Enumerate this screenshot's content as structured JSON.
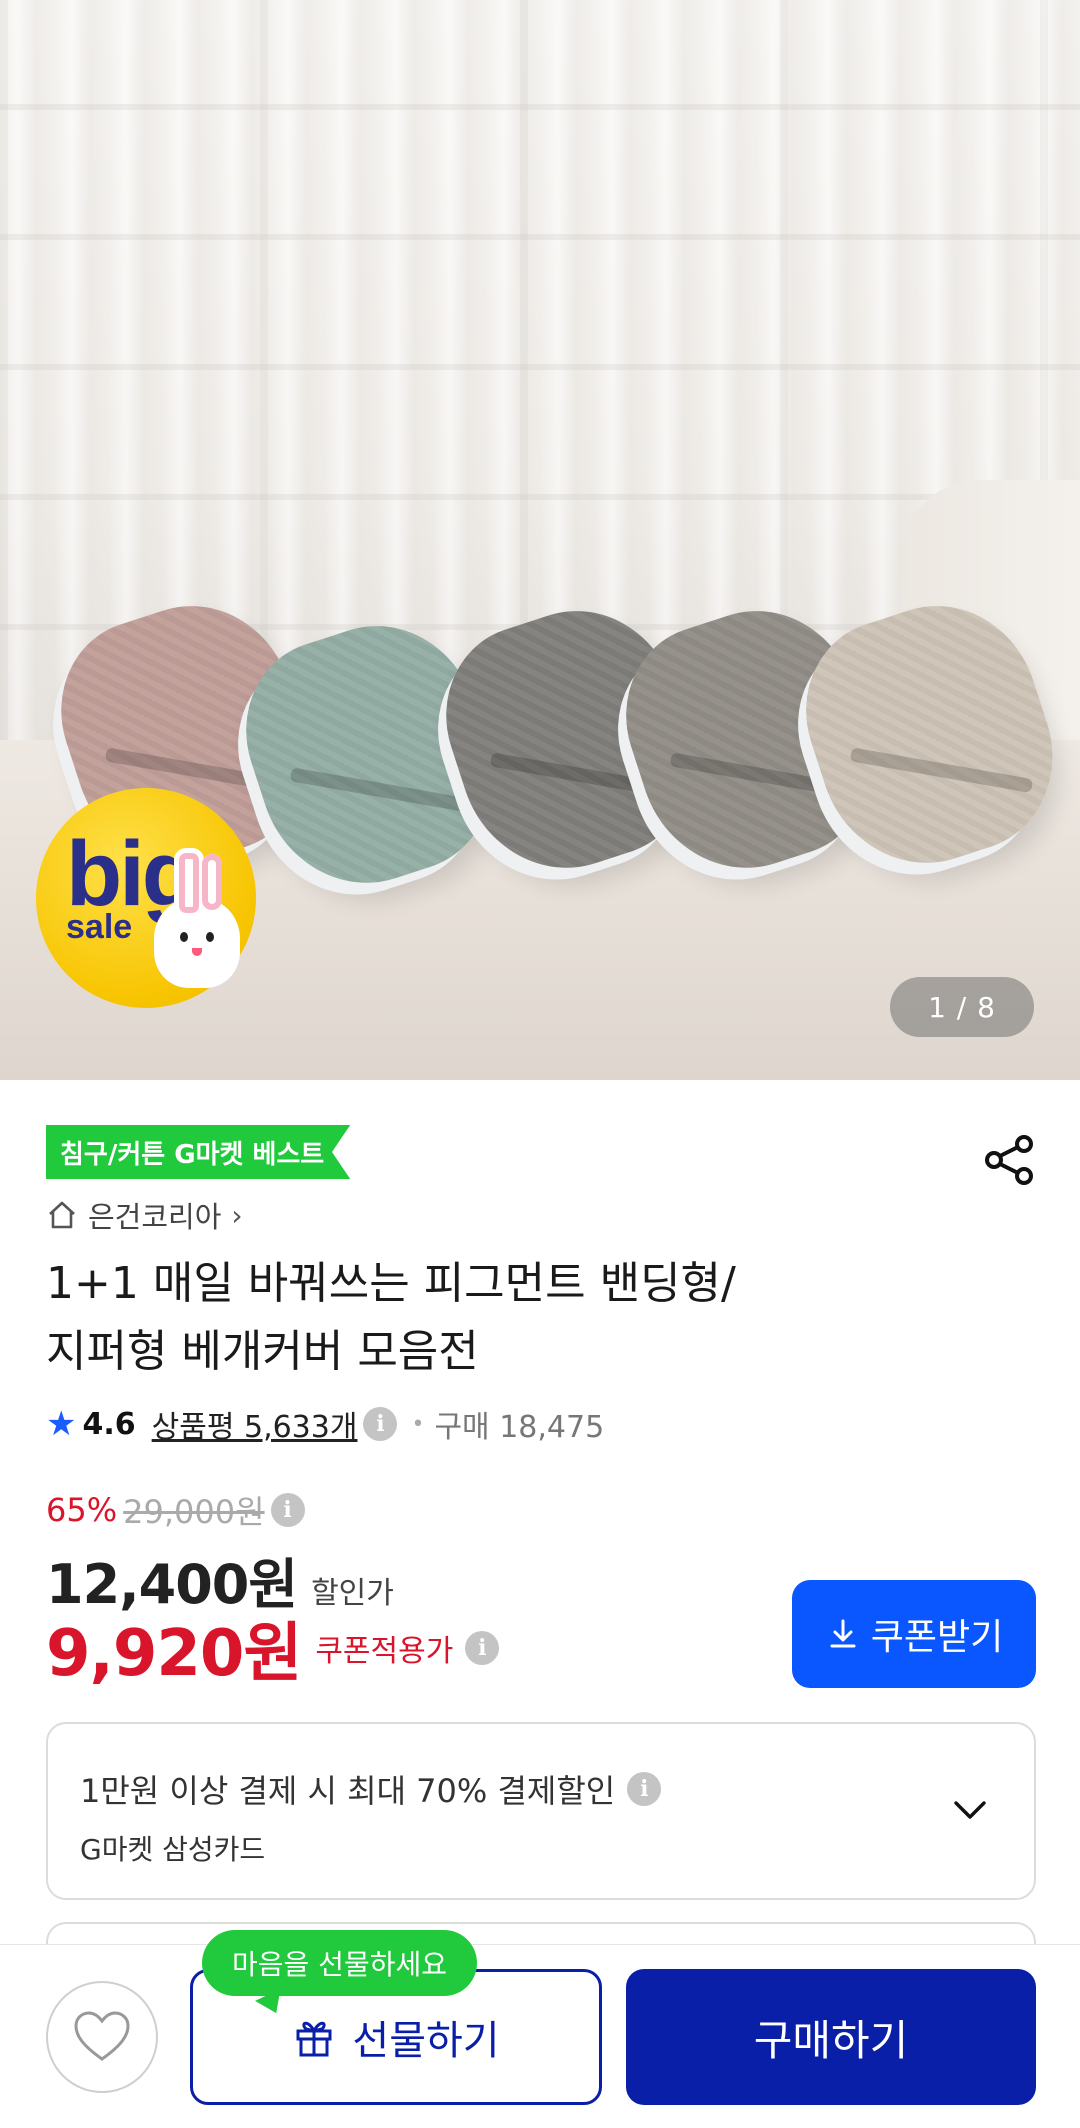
{
  "hero": {
    "counter": "1 / 8",
    "promo_badge": {
      "big": "big",
      "sale": "sale"
    }
  },
  "product": {
    "best_badge": "침구/커튼 G마켓 베스트",
    "brand": "은건코리아",
    "title_line1": "1+1 매일 바꿔쓰는 피그먼트 밴딩형/",
    "title_line2": "지퍼형 베개커버 모음전",
    "rating": "4.6",
    "reviews": "상품평 5,633개",
    "purchases": "구매 18,475"
  },
  "price": {
    "discount_pct": "65%",
    "original": "29,000원",
    "sale_price": "12,400원",
    "sale_label": "할인가",
    "coupon_price": "9,920원",
    "coupon_label": "쿠폰적용가",
    "coupon_button": "쿠폰받기"
  },
  "card_offer": {
    "line1": "1만원 이상 결제 시 최대  70% 결제할인",
    "line2": "G마켓 삼성카드"
  },
  "bottom_bar": {
    "gift_tooltip": "마음을 선물하세요",
    "gift_button": "선물하기",
    "buy_button": "구매하기"
  },
  "colors": {
    "accent_blue": "#0a56ff",
    "navy": "#0a1fa8",
    "sale_red": "#d9152b",
    "best_green": "#21c93c"
  },
  "icons": [
    "share-icon",
    "home-icon",
    "chevron-right-icon",
    "star-icon",
    "info-icon",
    "download-icon",
    "chevron-down-icon",
    "heart-icon",
    "gift-icon"
  ]
}
